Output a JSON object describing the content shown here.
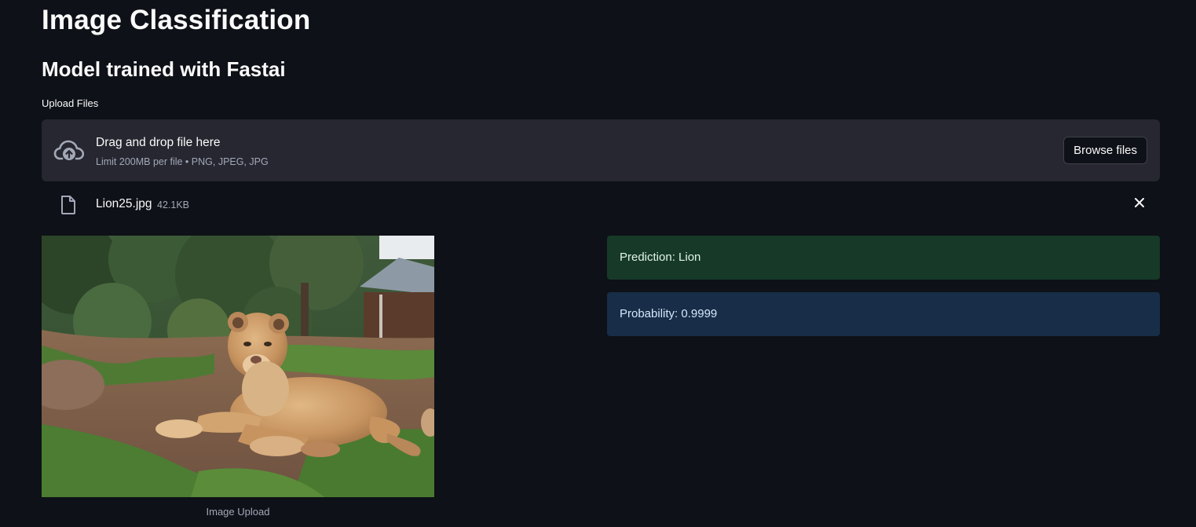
{
  "page": {
    "title": "Image Classification",
    "subtitle": "Model trained with Fastai"
  },
  "uploader": {
    "label": "Upload Files",
    "drop_title": "Drag and drop file here",
    "drop_limit": "Limit 200MB per file • PNG, JPEG, JPG",
    "browse_label": "Browse files",
    "file": {
      "name": "Lion25.jpg",
      "size": "42.1KB"
    }
  },
  "image": {
    "caption": "Image Upload"
  },
  "results": {
    "prediction": "Prediction: Lion",
    "probability": "Probability: 0.9999"
  },
  "colors": {
    "background": "#0e1117",
    "dropzone": "#262730",
    "success_bg": "#173928",
    "info_bg": "#172d48"
  },
  "icons": {
    "upload": "cloud-upload-icon",
    "file": "file-icon",
    "close": "close-icon"
  }
}
